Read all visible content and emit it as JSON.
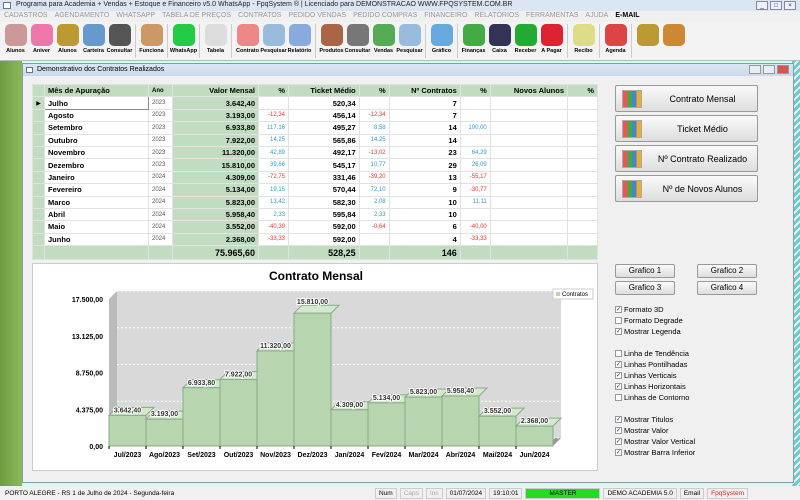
{
  "app": {
    "title": "Programa para Academia + Vendas + Estoque e Financeiro v5.0 WhatsApp - FpqSystem ® | Licenciado para  DEMONSTRACAO WWW.FPQSYSTEM.COM.BR"
  },
  "menu": [
    "CADASTROS",
    "AGENDAMENTO",
    "WHATSAPP",
    "TABELA DE PREÇOS",
    "CONTRATOS",
    "PEDIDO VENDAS",
    "PEDIDO COMPRAS",
    "FINANCEIRO",
    "RELATÓRIOS",
    "FERRAMENTAS",
    "AJUDA"
  ],
  "menu_email": "E-MAIL",
  "toolbar": [
    {
      "label": "Alunos",
      "color": "#c99"
    },
    {
      "label": "Aniver",
      "color": "#e7a"
    },
    {
      "label": "Alunos",
      "color": "#b93"
    },
    {
      "label": "Carteira",
      "color": "#69c"
    },
    {
      "label": "Consultar",
      "color": "#555"
    },
    {
      "sep": true
    },
    {
      "label": "Funciona",
      "color": "#c96"
    },
    {
      "sep": true
    },
    {
      "label": "WhatsApp",
      "color": "#2c4"
    },
    {
      "sep": true
    },
    {
      "label": "Tabela",
      "color": "#ddd"
    },
    {
      "sep": true
    },
    {
      "label": "Contrato",
      "color": "#e88"
    },
    {
      "label": "Pesquisar",
      "color": "#9bd"
    },
    {
      "label": "Relatório",
      "color": "#8ad"
    },
    {
      "sep": true
    },
    {
      "label": "Produtos",
      "color": "#a64"
    },
    {
      "label": "Consultar",
      "color": "#777"
    },
    {
      "label": "Vendas",
      "color": "#5a5"
    },
    {
      "label": "Pesquisar",
      "color": "#9bd"
    },
    {
      "sep": true
    },
    {
      "label": "Gráfico",
      "color": "#6ad"
    },
    {
      "sep": true
    },
    {
      "label": "Finanças",
      "color": "#4a4"
    },
    {
      "label": "Caixa",
      "color": "#335"
    },
    {
      "label": "Receber",
      "color": "#2a3"
    },
    {
      "label": "A Pagar",
      "color": "#d23"
    },
    {
      "sep": true
    },
    {
      "label": "Recibo",
      "color": "#dd8"
    },
    {
      "sep": true
    },
    {
      "label": "Agenda",
      "color": "#d44"
    },
    {
      "sep": true
    },
    {
      "label": "",
      "color": "#b93"
    },
    {
      "label": "",
      "color": "#c83"
    }
  ],
  "window": {
    "title": "Demonstrativo dos Contratos Realizados"
  },
  "table": {
    "headers": [
      "Mês de Apuração",
      "Ano",
      "Valor Mensal",
      "%",
      "Ticket Médio",
      "%",
      "Nº Contratos",
      "%",
      "Novos Alunos",
      "%"
    ],
    "rows": [
      [
        "Julho",
        "2023",
        "3.642,40",
        "",
        "520,34",
        "",
        "7",
        ""
      ],
      [
        "Agosto",
        "2023",
        "3.193,00",
        "-12,34",
        "456,14",
        "-12,34",
        "7",
        ""
      ],
      [
        "Setembro",
        "2023",
        "6.933,80",
        "117,16",
        "495,27",
        "8,58",
        "14",
        "100,00"
      ],
      [
        "Outubro",
        "2023",
        "7.922,00",
        "14,25",
        "565,86",
        "14,25",
        "14",
        ""
      ],
      [
        "Novembro",
        "2023",
        "11.320,00",
        "42,89",
        "492,17",
        "-13,02",
        "23",
        "64,29"
      ],
      [
        "Dezembro",
        "2023",
        "15.810,00",
        "39,66",
        "545,17",
        "10,77",
        "29",
        "26,09"
      ],
      [
        "Janeiro",
        "2024",
        "4.309,00",
        "-72,75",
        "331,46",
        "-39,20",
        "13",
        "-55,17"
      ],
      [
        "Fevereiro",
        "2024",
        "5.134,00",
        "19,15",
        "570,44",
        "72,10",
        "9",
        "-30,77"
      ],
      [
        "Marco",
        "2024",
        "5.823,00",
        "13,42",
        "582,30",
        "2,08",
        "10",
        "11,11"
      ],
      [
        "Abril",
        "2024",
        "5.958,40",
        "2,33",
        "595,84",
        "2,33",
        "10",
        ""
      ],
      [
        "Maio",
        "2024",
        "3.552,00",
        "-40,39",
        "592,00",
        "-0,64",
        "6",
        "-40,00"
      ],
      [
        "Junho",
        "2024",
        "2.368,00",
        "-33,33",
        "592,00",
        "",
        "4",
        "-33,33"
      ]
    ],
    "totals": {
      "valor": "75.965,60",
      "ticket": "528,25",
      "contratos": "146"
    }
  },
  "side_buttons": [
    "Contrato Mensal",
    "Ticket Médio",
    "Nº Contrato Realizado",
    "Nº de Novos Alunos"
  ],
  "graph_buttons": [
    "Grafico 1",
    "Grafico 2",
    "Grafico 3",
    "Grafico 4"
  ],
  "options": [
    [
      {
        "label": "Formato 3D",
        "checked": true
      },
      {
        "label": "Formato Degrade",
        "checked": false
      },
      {
        "label": "Mostrar Legenda",
        "checked": true
      }
    ],
    [
      {
        "label": "Linha de Tendência",
        "checked": false
      },
      {
        "label": "Linhas Pontilhadas",
        "checked": true
      },
      {
        "label": "Linhas Verticais",
        "checked": true
      },
      {
        "label": "Linhas Horizontais",
        "checked": true
      },
      {
        "label": "Linhas de Contorno",
        "checked": false
      }
    ],
    [
      {
        "label": "Mostrar Titulos",
        "checked": true
      },
      {
        "label": "Mostrar Valor",
        "checked": true
      },
      {
        "label": "Mostrar Valor Vertical",
        "checked": true
      },
      {
        "label": "Mostrar Barra Inferior",
        "checked": true
      }
    ]
  ],
  "chart_data": {
    "type": "bar",
    "title": "Contrato Mensal",
    "legend": "Contratos",
    "legend_position": "top-right",
    "categories": [
      "Jul/2023",
      "Ago/2023",
      "Set/2023",
      "Out/2023",
      "Nov/2023",
      "Dez/2023",
      "Jan/2024",
      "Fev/2024",
      "Mar/2024",
      "Abr/2024",
      "Mai/2024",
      "Jun/2024"
    ],
    "values": [
      3642.4,
      3193.0,
      6933.8,
      7922.0,
      11320.0,
      15810.0,
      4309.0,
      5134.0,
      5823.0,
      5958.4,
      3552.0,
      2368.0
    ],
    "labels": [
      "3.642,40",
      "3.193,00",
      "6.933,80",
      "7.922,00",
      "11.320,00",
      "15.810,00",
      "4.309,00",
      "5.134,00",
      "5.823,00",
      "5.958,40",
      "3.552,00",
      "2.368,00"
    ],
    "yticks": [
      "17.500,00",
      "13.125,00",
      "8.750,00",
      "4.375,00",
      "0,00"
    ],
    "ylim": [
      0,
      17500
    ],
    "color": "#b7d6b0"
  },
  "status": {
    "location": "PORTO ALEGRE - RS  1 de Julho de 2024 - Segunda-feira",
    "num": "Num",
    "caps": "Caps",
    "ins": "Ins",
    "date": "01/07/2024",
    "time": "19:10:01",
    "user": "MASTER",
    "company": "DEMO ACADEMIA 5.0",
    "email": "Email",
    "brand": "FpqSystem"
  }
}
